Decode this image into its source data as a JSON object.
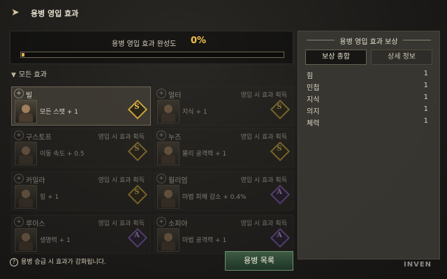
{
  "window": {
    "title": "용병 영입 효과"
  },
  "progress": {
    "label": "용병 영입 효과 완성도",
    "value": "0%",
    "fraction": 0.01
  },
  "filter": {
    "label": "모든 효과"
  },
  "cards": [
    {
      "name": "빌",
      "condition": "",
      "effect": "모든 스탯 + 1",
      "badge": "S",
      "badge_color": "#c9a53c",
      "state": "active"
    },
    {
      "name": "얼터",
      "condition": "영입 시 효과 획득",
      "effect": "지식 + 1",
      "badge": "S",
      "badge_color": "#c9a53c",
      "state": "dim"
    },
    {
      "name": "구스토프",
      "condition": "영입 시 효과 획득",
      "effect": "이동 속도 + 0.5",
      "badge": "S",
      "badge_color": "#c9a53c",
      "state": "dim"
    },
    {
      "name": "누즈",
      "condition": "영입 시 효과 획득",
      "effect": "물리 공격력 + 1",
      "badge": "S",
      "badge_color": "#c9a53c",
      "state": "dim"
    },
    {
      "name": "카밀라",
      "condition": "영입 시 효과 획득",
      "effect": "힘 + 1",
      "badge": "S",
      "badge_color": "#c9a53c",
      "state": "dim"
    },
    {
      "name": "윌리엄",
      "condition": "영입 시 효과 획득",
      "effect": "마법 피해 감소 + 0.4%",
      "badge": "A",
      "badge_color": "#8a5fc0",
      "state": "dim"
    },
    {
      "name": "루이스",
      "condition": "영입 시 효과 획득",
      "effect": "생명력 + 1",
      "badge": "A",
      "badge_color": "#8a5fc0",
      "state": "dim"
    },
    {
      "name": "소피아",
      "condition": "영입 시 효과 획득",
      "effect": "마법 공격력 + 1",
      "badge": "A",
      "badge_color": "#8a5fc0",
      "state": "dim"
    }
  ],
  "reward_panel": {
    "title": "용병 영입 효과 보상",
    "tabs": [
      "보상 종합",
      "상세 정보"
    ],
    "stats": [
      {
        "name": "힘",
        "value": "1"
      },
      {
        "name": "민첩",
        "value": "1"
      },
      {
        "name": "지식",
        "value": "1"
      },
      {
        "name": "의지",
        "value": "1"
      },
      {
        "name": "체력",
        "value": "1"
      }
    ]
  },
  "footer": {
    "help_text": "용병 승급 시 효과가 강화됩니다.",
    "list_button": "용병 목록",
    "watermark": "INVEN"
  }
}
